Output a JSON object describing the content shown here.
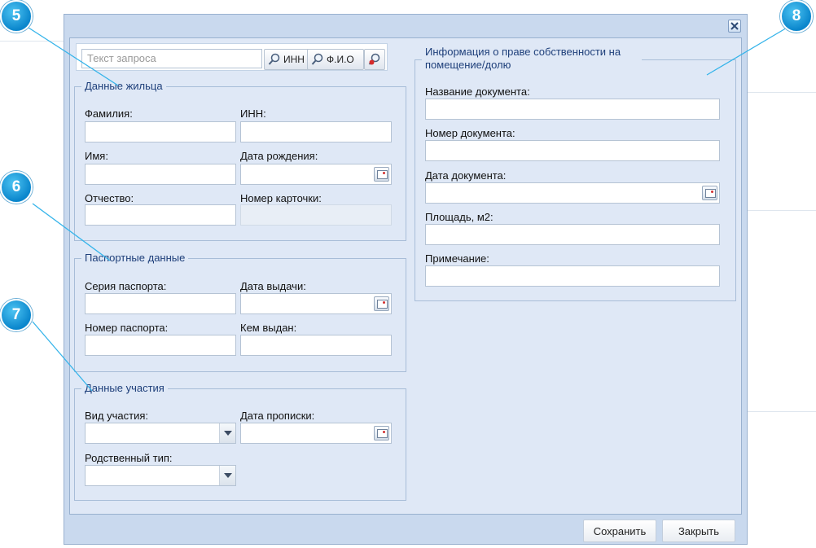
{
  "search": {
    "placeholder": "Текст запроса",
    "inn_button": "ИНН",
    "fio_button": "Ф.И.О"
  },
  "resident": {
    "legend": "Данные жильца",
    "lastname_label": "Фамилия:",
    "inn_label": "ИНН:",
    "firstname_label": "Имя:",
    "birthdate_label": "Дата рождения:",
    "patronymic_label": "Отчество:",
    "card_number_label": "Номер карточки:"
  },
  "passport": {
    "legend": "Паспортные данные",
    "series_label": "Серия паспорта:",
    "issue_date_label": "Дата выдачи:",
    "number_label": "Номер паспорта:",
    "issued_by_label": "Кем выдан:"
  },
  "participation": {
    "legend": "Данные участия",
    "type_label": "Вид участия:",
    "registration_date_label": "Дата прописки:",
    "relation_label": "Родственный тип:"
  },
  "ownership": {
    "legend": "Информация о праве собственности на помещение/долю",
    "doc_name_label": "Название документа:",
    "doc_number_label": "Номер документа:",
    "doc_date_label": "Дата документа:",
    "area_label": "Площадь, м2:",
    "note_label": "Примечание:"
  },
  "footer": {
    "save_label": "Сохранить",
    "close_label": "Закрыть"
  },
  "callouts": [
    "5",
    "6",
    "7",
    "8"
  ],
  "colors": {
    "window": "#c9d9ee",
    "panel": "#dfe8f6",
    "legend_text": "#1e3f7a",
    "marker": "#0a86cc"
  }
}
